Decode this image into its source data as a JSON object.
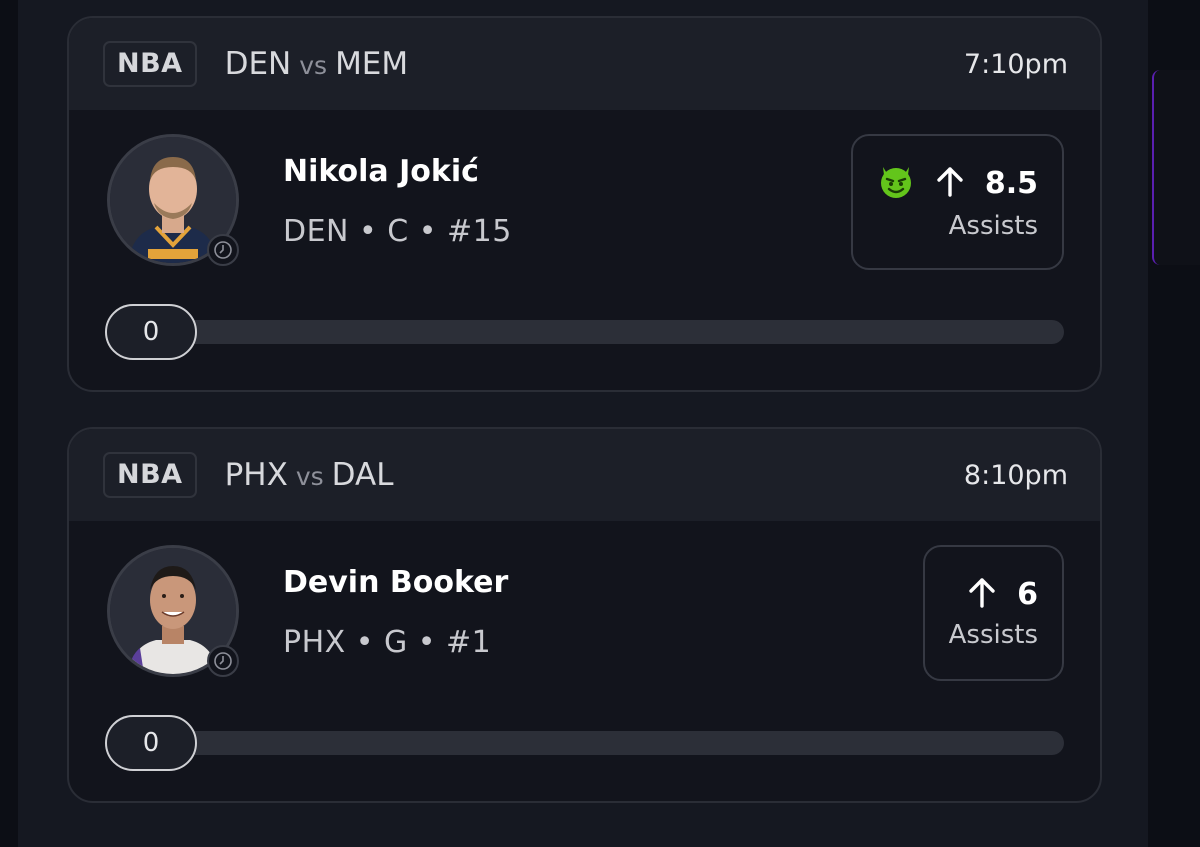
{
  "colors": {
    "background": "#0c0e15",
    "card": "#12141c",
    "header": "#1c1f28",
    "accent_purple": "#5a1fb0",
    "demon_icon_green": "#63c51b"
  },
  "picks": [
    {
      "league": "NBA",
      "home": "DEN",
      "vs": "vs",
      "away": "MEM",
      "time": "7:10pm",
      "player_name": "Nikola Jokić",
      "player_meta": "DEN • C • #15",
      "direction_icon": "arrow-up-icon",
      "line": "8.5",
      "stat": "Assists",
      "has_demon_icon": true,
      "progress_value": "0",
      "progress_fraction": 0,
      "jersey_color": "#1d2b4a"
    },
    {
      "league": "NBA",
      "home": "PHX",
      "vs": "vs",
      "away": "DAL",
      "time": "8:10pm",
      "player_name": "Devin Booker",
      "player_meta": "PHX • G • #1",
      "direction_icon": "arrow-up-icon",
      "line": "6",
      "stat": "Assists",
      "has_demon_icon": false,
      "progress_value": "0",
      "progress_fraction": 0,
      "jersey_color": "#e8e6e4"
    }
  ]
}
